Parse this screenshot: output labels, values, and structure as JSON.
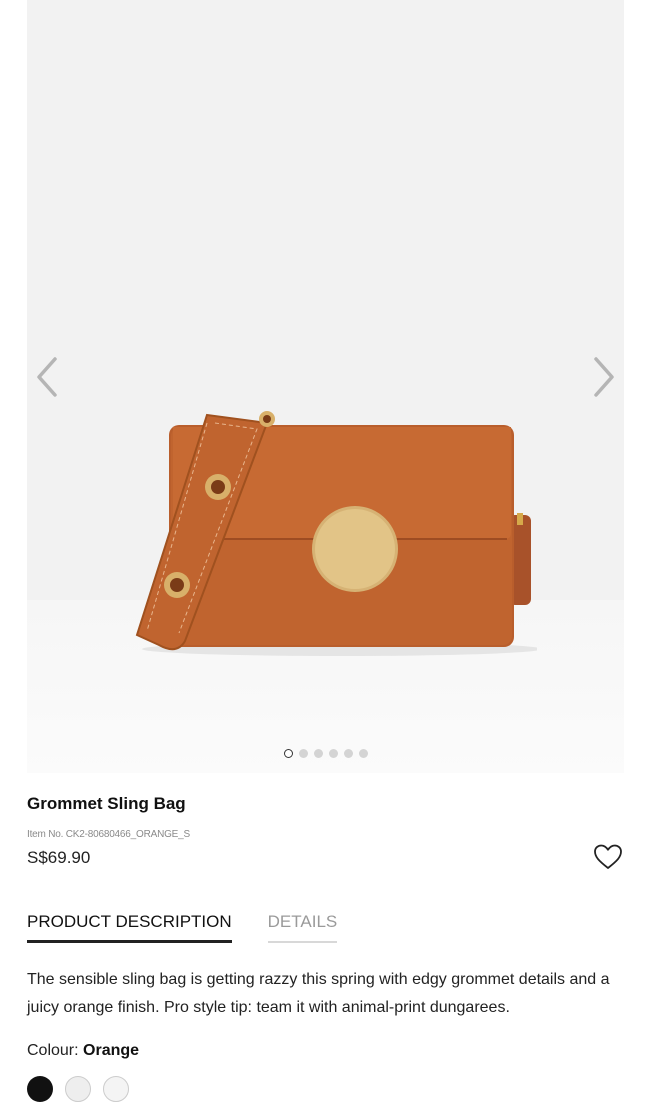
{
  "product": {
    "name": "Grommet Sling Bag",
    "item_no": "Item No. CK2-80680466_ORANGE_S",
    "price": "S$69.90",
    "colour_label": "Colour:",
    "colour_value": "Orange"
  },
  "gallery": {
    "image_count": 6,
    "active_index": 0,
    "prev_icon": "chevron-left-icon",
    "next_icon": "chevron-right-icon"
  },
  "tabs": [
    {
      "label": "PRODUCT DESCRIPTION",
      "active": true
    },
    {
      "label": "DETAILS",
      "active": false
    }
  ],
  "description": "The sensible sling bag is getting razzy this spring with edgy grommet details and a juicy orange finish. Pro style tip: team it with animal-print dungarees.",
  "colors": {
    "bag": "#c0642f",
    "clasp": "#dcb877",
    "accent": "#222222"
  }
}
